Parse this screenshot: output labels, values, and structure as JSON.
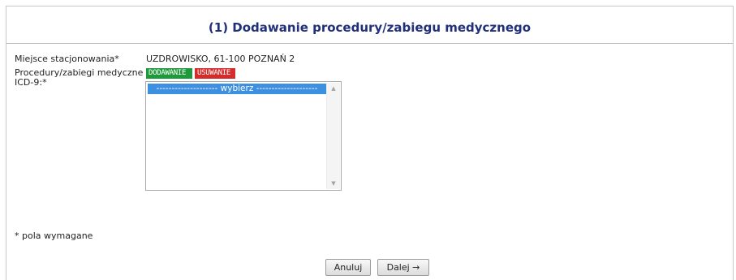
{
  "page": {
    "title": "(1) Dodawanie procedury/zabiegu medycznego"
  },
  "form": {
    "location": {
      "label": "Miejsce stacjonowania*",
      "value": "UZDROWISKO, 61-100 POZNAŃ 2"
    },
    "procedures": {
      "label_line1": "Procedury/zabiegi medyczne",
      "label_line2": "ICD-9:*",
      "add_badge": "DODAWANIE",
      "remove_badge": "USUWANIE",
      "options": [
        "-------------------- wybierz --------------------"
      ],
      "selected_index": 0
    },
    "required_note": "* pola wymagane"
  },
  "actions": {
    "cancel_label": "Anuluj",
    "next_label": "Dalej →"
  },
  "colors": {
    "title": "#1f2f7a",
    "add_badge": "#1e9a3a",
    "remove_badge": "#d42b2b",
    "selection": "#3d8fe0"
  },
  "icons": {
    "scroll_up": "scroll-up-arrow-icon",
    "scroll_down": "scroll-down-arrow-icon"
  }
}
